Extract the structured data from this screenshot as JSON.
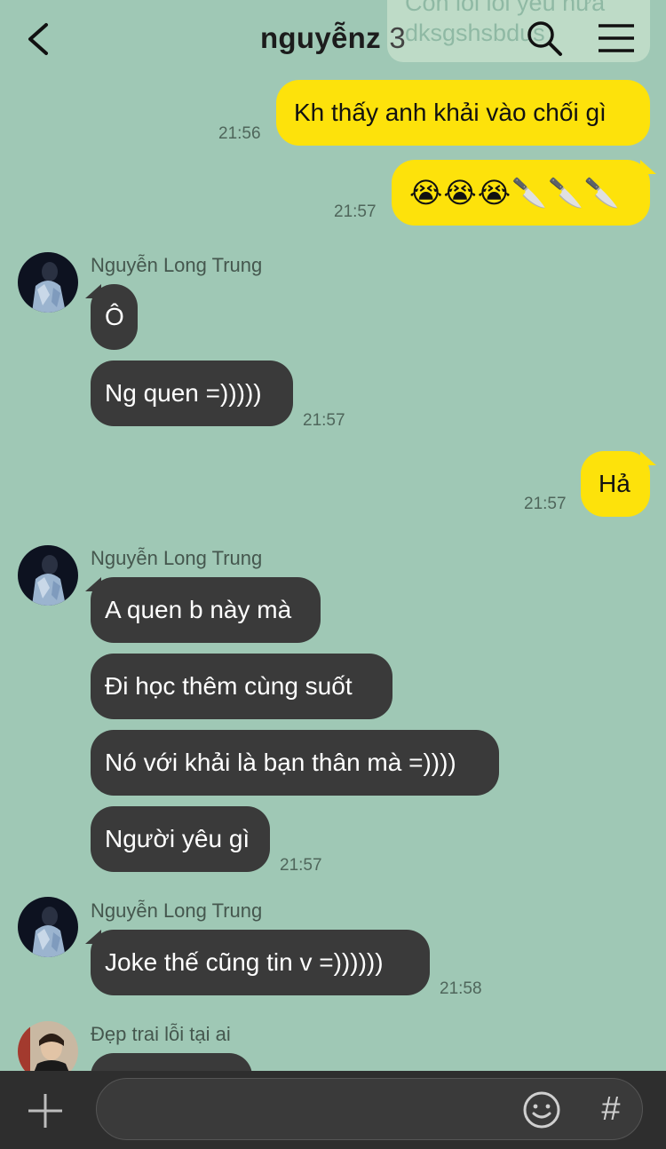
{
  "header": {
    "title": "nguyễnz",
    "member_count": "3",
    "ghost_lines": [
      "Còn lỗi lỗi yêu nữa",
      "dksgshsbdus"
    ]
  },
  "messages": [
    {
      "type": "me",
      "text": "Kh thấy anh khải vào chối gì",
      "time": "21:56"
    },
    {
      "type": "me",
      "text": "😭😭😭🔪🔪🔪",
      "time": "21:57"
    },
    {
      "type": "sender",
      "name": "Nguyễn Long Trung"
    },
    {
      "type": "other",
      "text": "Ô"
    },
    {
      "type": "other",
      "text": "Ng quen =)))))",
      "time": "21:57"
    },
    {
      "type": "me",
      "text": "Hả",
      "time": "21:57"
    },
    {
      "type": "sender",
      "name": "Nguyễn Long Trung"
    },
    {
      "type": "other",
      "text": "A quen b này mà"
    },
    {
      "type": "other",
      "text": "Đi học thêm cùng suốt"
    },
    {
      "type": "other",
      "text": "Nó với khải là bạn thân mà =))))"
    },
    {
      "type": "other",
      "text": "Người yêu gì",
      "time": "21:57"
    },
    {
      "type": "sender",
      "name": "Nguyễn Long Trung"
    },
    {
      "type": "other",
      "text": "Joke thế cũng tin v =))))))",
      "time": "21:58"
    },
    {
      "type": "sender",
      "name": "Đẹp trai lỗi tại ai"
    }
  ],
  "input": {
    "placeholder": ""
  },
  "bottom": {
    "hash_label": "#"
  },
  "colors": {
    "background": "#9fc8b5",
    "my_bubble": "#fde20b",
    "other_bubble": "#3a3a3a",
    "bottom_bar": "#2e2e2e"
  }
}
